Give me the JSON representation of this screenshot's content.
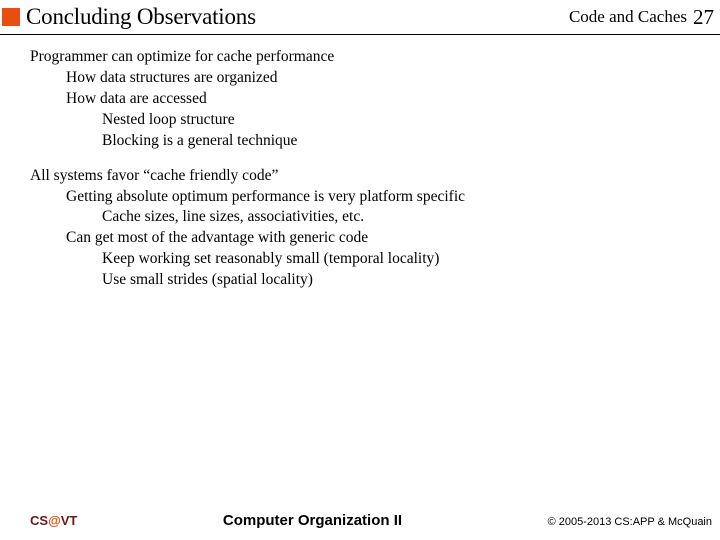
{
  "header": {
    "title": "Concluding Observations",
    "topic": "Code and Caches",
    "page": "27"
  },
  "body": {
    "section1": {
      "l0": "Programmer can optimize for cache performance",
      "l1a": "How data structures are organized",
      "l1b": "How data are accessed",
      "l2a": "Nested loop structure",
      "l2b": "Blocking is a general technique"
    },
    "section2": {
      "l0": "All systems favor “cache friendly code”",
      "l1a": "Getting absolute optimum performance is very platform specific",
      "l2a": "Cache sizes, line sizes, associativities, etc.",
      "l1b": "Can get most of the advantage with generic code",
      "l2b": "Keep working set reasonably small (temporal locality)",
      "l2c": "Use small strides (spatial locality)"
    }
  },
  "footer": {
    "cs": "CS",
    "at": "@",
    "vt": "VT",
    "course": "Computer Organization II",
    "copy": "© 2005-2013 CS:APP & McQuain"
  }
}
